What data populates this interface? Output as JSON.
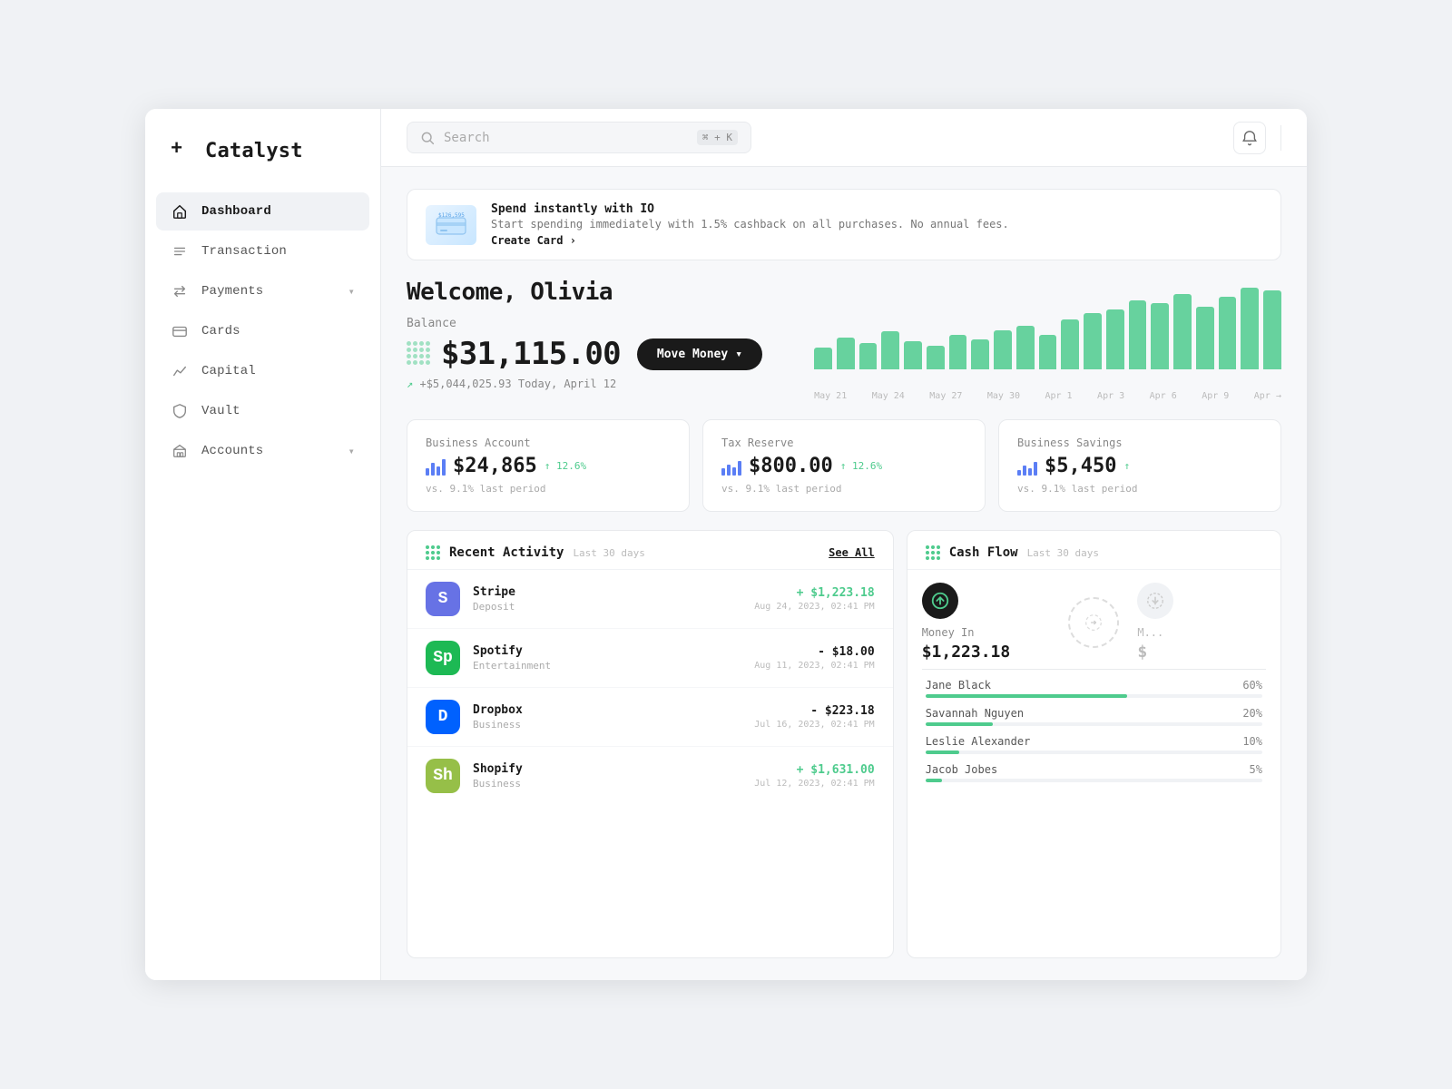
{
  "logo": {
    "icon": "+",
    "text": "Catalyst"
  },
  "sidebar": {
    "items": [
      {
        "id": "dashboard",
        "label": "Dashboard",
        "icon": "home",
        "active": true,
        "chevron": false
      },
      {
        "id": "transaction",
        "label": "Transaction",
        "icon": "list",
        "active": false,
        "chevron": false
      },
      {
        "id": "payments",
        "label": "Payments",
        "icon": "transfer",
        "active": false,
        "chevron": true
      },
      {
        "id": "cards",
        "label": "Cards",
        "icon": "card",
        "active": false,
        "chevron": false
      },
      {
        "id": "capital",
        "label": "Capital",
        "icon": "chart",
        "active": false,
        "chevron": false
      },
      {
        "id": "vault",
        "label": "Vault",
        "icon": "shield",
        "active": false,
        "chevron": false
      },
      {
        "id": "accounts",
        "label": "Accounts",
        "icon": "building",
        "active": false,
        "chevron": true
      }
    ]
  },
  "topbar": {
    "search_placeholder": "Search",
    "search_kbd": "⌘ + K",
    "bell_icon": "🔔"
  },
  "banner": {
    "title": "Spend instantly with IO",
    "sub": "Start spending immediately with 1.5% cashback on all purchases. No annual fees.",
    "link": "Create Card ›"
  },
  "welcome": {
    "greeting": "Welcome, Olivia",
    "balance_label": "Balance",
    "balance": "$31,115.00",
    "move_money": "Move Money",
    "change": "+$5,044,025.93",
    "change_date": "Today, April 12"
  },
  "chart": {
    "bars": [
      35,
      50,
      42,
      60,
      45,
      38,
      55,
      48,
      62,
      70,
      55,
      80,
      90,
      95,
      110,
      105,
      120,
      100,
      115,
      130,
      125
    ],
    "labels": [
      "May 21",
      "May 24",
      "May 27",
      "May 30",
      "Apr 1",
      "Apr 3",
      "Apr 6",
      "Apr 9",
      "Apr →"
    ]
  },
  "accounts": [
    {
      "title": "Business Account",
      "amount": "$24,865",
      "change": "↑ 12.6%",
      "vs": "vs. 9.1% last period"
    },
    {
      "title": "Tax Reserve",
      "amount": "$800.00",
      "change": "↑ 12.6%",
      "vs": "vs. 9.1% last period"
    },
    {
      "title": "Business Savings",
      "amount": "$5,450",
      "change": "↑",
      "vs": "vs. 9.1% last period"
    }
  ],
  "activity": {
    "title": "Recent Activity",
    "sub": "Last 30 days",
    "see_all": "See All",
    "items": [
      {
        "name": "Stripe",
        "category": "Deposit",
        "amount": "+ $1,223.18",
        "positive": true,
        "date": "Aug 24, 2023, 02:41 PM",
        "color": "#6772e5",
        "abbr": "S"
      },
      {
        "name": "Spotify",
        "category": "Entertainment",
        "amount": "- $18.00",
        "positive": false,
        "date": "Aug 11, 2023, 02:41 PM",
        "color": "#1DB954",
        "abbr": "Sp"
      },
      {
        "name": "Dropbox",
        "category": "Business",
        "amount": "- $223.18",
        "positive": false,
        "date": "Jul 16, 2023, 02:41 PM",
        "color": "#0061FE",
        "abbr": "D"
      },
      {
        "name": "Shopify",
        "category": "Business",
        "amount": "+ $1,631.00",
        "positive": true,
        "date": "Jul 12, 2023, 02:41 PM",
        "color": "#96BF48",
        "abbr": "Sh"
      }
    ]
  },
  "cashflow": {
    "title": "Cash Flow",
    "sub": "Last 30 days",
    "money_in_label": "Money In",
    "money_in_amount": "$1,223.18",
    "money_out_label": "M...",
    "money_out_amount": "$",
    "breakdown": [
      {
        "name": "Jane Black",
        "pct": 60,
        "pct_label": "60%"
      },
      {
        "name": "Savannah Nguyen",
        "pct": 20,
        "pct_label": "20%"
      },
      {
        "name": "Leslie Alexander",
        "pct": 10,
        "pct_label": "10%"
      },
      {
        "name": "Jacob Jobes",
        "pct": 5,
        "pct_label": "5%"
      }
    ]
  }
}
